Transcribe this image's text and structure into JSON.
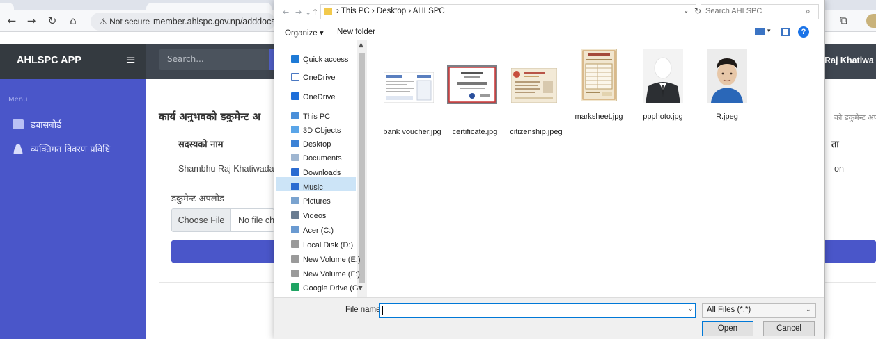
{
  "browser": {
    "url": "member.ahlspc.gov.np/adddocs",
    "security_label": "Not secure"
  },
  "app": {
    "brand": "AHLSPC APP",
    "search_placeholder": "Search...",
    "user_name": "Raj Khatiwa",
    "sidebar": {
      "menu_label": "Menu",
      "items": [
        {
          "label": "ड्यासबोर्ड",
          "icon": "dashboard-icon"
        },
        {
          "label": "व्यक्तिगत विवरण प्रविष्टि",
          "icon": "user-icon"
        }
      ]
    },
    "page_title": "कार्य अनुभवको डकुमेन्ट अ",
    "breadcrumb_right": "को डकुमेन्ट अप",
    "table": {
      "header_name": "सदस्यको नाम",
      "header_right": "ता",
      "row_name": "Shambhu Raj Khatiwada",
      "row_right": "on"
    },
    "upload": {
      "label": "डकुमेन्ट अपलोड",
      "choose_button": "Choose File",
      "no_file_text": "No file ch"
    }
  },
  "dialog": {
    "breadcrumbs": "›  This PC  ›  Desktop  ›  AHLSPC",
    "search_placeholder": "Search AHLSPC",
    "organize_label": "Organize ▾",
    "new_folder_label": "New folder",
    "nav_items": [
      {
        "label": "Quick access",
        "icon": "star-icon",
        "color": "#1e7ad6"
      },
      {
        "label": "OneDrive",
        "icon": "onedrive-icon",
        "color": "#ffffff"
      },
      {
        "label": "OneDrive",
        "icon": "cloud-icon",
        "color": "#1e6fd9"
      },
      {
        "label": "This PC",
        "icon": "computer-icon",
        "color": "#4a8fd9"
      },
      {
        "label": "3D Objects",
        "icon": "cube-icon",
        "color": "#5aa5e8"
      },
      {
        "label": "Desktop",
        "icon": "desktop-icon",
        "color": "#3c82d6"
      },
      {
        "label": "Documents",
        "icon": "documents-icon",
        "color": "#9fb6d1"
      },
      {
        "label": "Downloads",
        "icon": "download-icon",
        "color": "#2a6bd1"
      },
      {
        "label": "Music",
        "icon": "music-icon",
        "color": "#2a6bd1"
      },
      {
        "label": "Pictures",
        "icon": "pictures-icon",
        "color": "#7aa3cf"
      },
      {
        "label": "Videos",
        "icon": "videos-icon",
        "color": "#6a7c91"
      },
      {
        "label": "Acer (C:)",
        "icon": "drive-icon",
        "color": "#6a9ad1"
      },
      {
        "label": "Local Disk (D:)",
        "icon": "disk-icon",
        "color": "#9a9a9a"
      },
      {
        "label": "New Volume (E:)",
        "icon": "disk-icon",
        "color": "#9a9a9a"
      },
      {
        "label": "New Volume (F:)",
        "icon": "disk-icon",
        "color": "#9a9a9a"
      },
      {
        "label": "Google Drive (G:",
        "icon": "google-drive-icon",
        "color": "#1fa463"
      }
    ],
    "selected_nav": "Desktop",
    "files": [
      {
        "name": "bank voucher.jpg",
        "icon": "voucher-thumbnail"
      },
      {
        "name": "certificate.jpg",
        "icon": "certificate-thumbnail"
      },
      {
        "name": "citizenship.jpeg",
        "icon": "citizenship-thumbnail"
      },
      {
        "name": "marksheet.jpg",
        "icon": "marksheet-thumbnail"
      },
      {
        "name": "ppphoto.jpg",
        "icon": "passport-photo-thumbnail"
      },
      {
        "name": "R.jpeg",
        "icon": "portrait-thumbnail"
      }
    ],
    "file_name_label": "File name:",
    "file_name_value": "",
    "filter_value": "All Files (*.*)",
    "open_label": "Open",
    "cancel_label": "Cancel"
  },
  "colors": {
    "sidebar": "#4a56c9",
    "header_dark": "#343a40",
    "selection": "#cce4f7",
    "focus_border": "#0078d7"
  }
}
